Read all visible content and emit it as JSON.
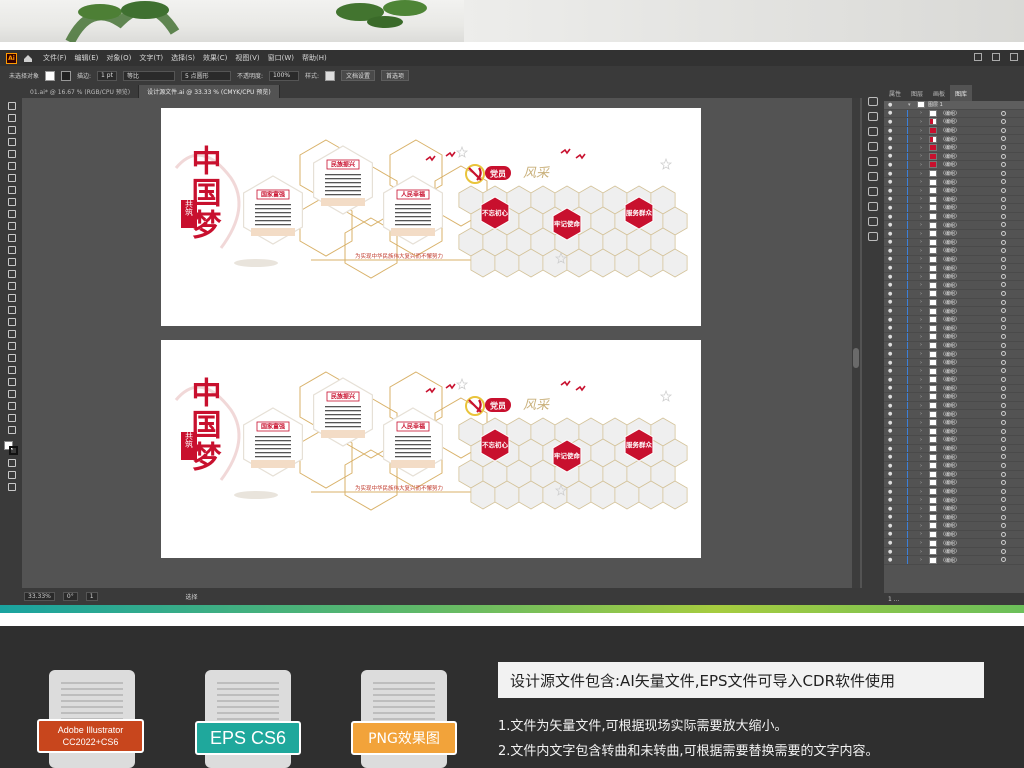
{
  "app": {
    "logo": "Ai",
    "menu": [
      "文件(F)",
      "编辑(E)",
      "对象(O)",
      "文字(T)",
      "选择(S)",
      "效果(C)",
      "视图(V)",
      "窗口(W)",
      "帮助(H)"
    ]
  },
  "control_bar": {
    "no_selection": "未选择对象",
    "stroke_label": "描边:",
    "stroke_value": "1 pt",
    "stroke_style": "等比",
    "brush": "5 点圆形",
    "opacity_label": "不透明度:",
    "opacity_value": "100%",
    "style_label": "样式:",
    "doc_settings": "文档设置",
    "preferences": "首选项"
  },
  "tabs": [
    {
      "label": "01.ai* @ 16.67 % (RGB/CPU 预览)",
      "active": false
    },
    {
      "label": "设计源文件.ai @ 33.33 % (CMYK/CPU 预览)",
      "active": true
    }
  ],
  "artwork": {
    "title_main": "中国梦",
    "title_sub": "共筑",
    "card_titles": [
      "国家富强",
      "民族振兴",
      "人民幸福"
    ],
    "slogan": "为实现中华民族伟大复兴而不懈努力",
    "party_title_1": "党员",
    "party_title_2": "风采",
    "hex_labels": [
      "不忘初心",
      "牢记使命",
      "服务群众"
    ]
  },
  "status": {
    "zoom": "33.33%",
    "rotation": "0°",
    "artboard": "1",
    "mode": "选择"
  },
  "layers_panel": {
    "tabs": [
      "属性",
      "图层",
      "画板",
      "图库"
    ],
    "top_layer": "图层 1",
    "item_label": "〈编组〉",
    "footer": "1 ..."
  },
  "colors": {
    "party_red": "#c8102e",
    "gold": "#d9b26a",
    "ai_orange": "#c8461d",
    "eps_teal": "#1fa89c",
    "png_orange": "#f2a33a"
  },
  "bottom": {
    "badges": [
      {
        "line1": "Adobe Illustrator",
        "line2": "CC2022+CS6"
      },
      {
        "line1": "EPS CS6"
      },
      {
        "line1": "PNG效果图"
      }
    ],
    "info_title": "设计源文件包含:AI矢量文件,EPS文件可导入CDR软件使用",
    "notes": [
      "1.文件为矢量文件,可根据现场实际需要放大缩小。",
      "2.文件内文字包含转曲和未转曲,可根据需要替换需要的文字内容。"
    ]
  }
}
